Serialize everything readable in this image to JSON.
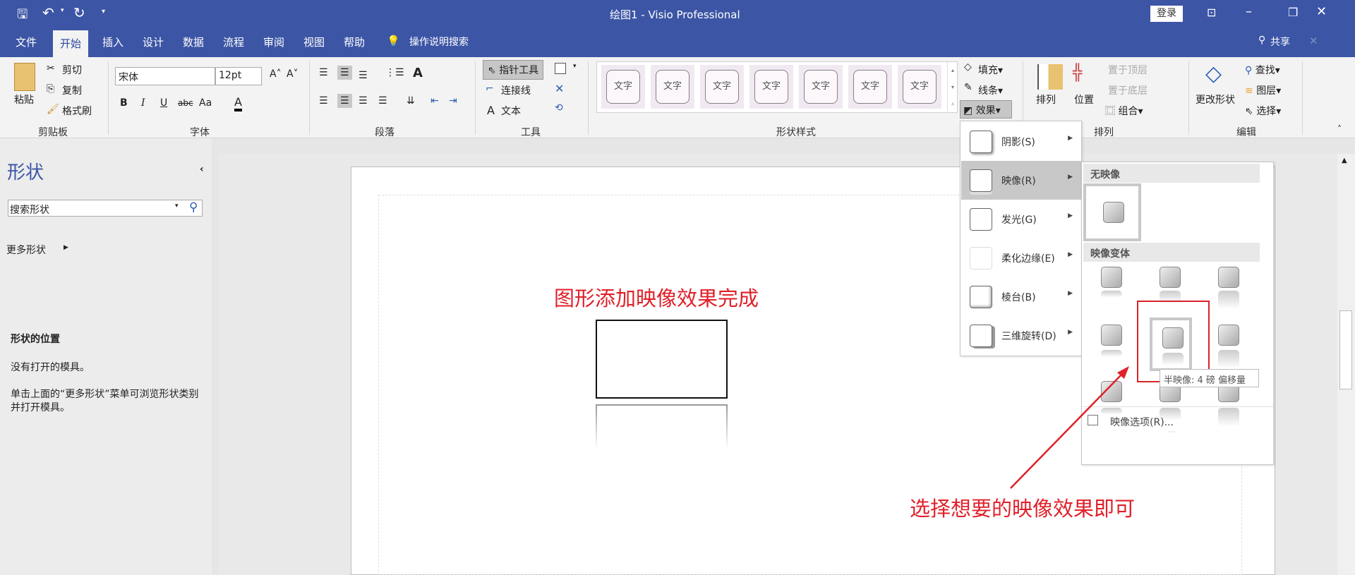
{
  "titlebar": {
    "title": "绘图1 - Visio Professional",
    "login": "登录",
    "quick_access": [
      "save-icon",
      "undo-icon",
      "redo-icon",
      "customize-icon"
    ]
  },
  "tabs": {
    "items": [
      "文件",
      "开始",
      "插入",
      "设计",
      "数据",
      "流程",
      "审阅",
      "视图",
      "帮助"
    ],
    "active": "开始",
    "tell_me": "操作说明搜索",
    "share": "共享"
  },
  "ribbon": {
    "clipboard": {
      "label": "剪贴板",
      "paste": "粘贴",
      "cut": "剪切",
      "copy": "复制",
      "format_painter": "格式刷"
    },
    "font": {
      "label": "字体",
      "font_name": "宋体",
      "font_size": "12pt",
      "bold": "B",
      "italic": "I",
      "underline": "U",
      "strike": "abc",
      "case": "Aa",
      "color": "A"
    },
    "paragraph": {
      "label": "段落"
    },
    "tools": {
      "label": "工具",
      "pointer": "指针工具",
      "connector": "连接线",
      "text": "文本"
    },
    "shape_styles": {
      "label": "形状样式",
      "items": [
        "文字",
        "文字",
        "文字",
        "文字",
        "文字",
        "文字",
        "文字"
      ],
      "fill": "填充",
      "line": "线条",
      "effects": "效果"
    },
    "arrange": {
      "label": "排列",
      "arrange": "排列",
      "position": "位置",
      "bring_front": "置于顶层",
      "send_back": "置于底层",
      "group": "组合"
    },
    "editing": {
      "label": "编辑",
      "change_shape": "更改形状",
      "find": "查找",
      "layers": "图层",
      "select": "选择"
    }
  },
  "shapes_panel": {
    "title": "形状",
    "search_placeholder": "搜索形状",
    "more_shapes": "更多形状",
    "location_heading": "形状的位置",
    "no_stencils": "没有打开的模具。",
    "hint": "单击上面的“更多形状”菜单可浏览形状类别并打开模具。"
  },
  "canvas": {
    "annotation_top": "图形添加映像效果完成",
    "annotation_bottom": "选择想要的映像效果即可",
    "annotation_color": "#e0202a"
  },
  "effects_menu": {
    "items": [
      {
        "label": "阴影(S)"
      },
      {
        "label": "映像(R)"
      },
      {
        "label": "发光(G)"
      },
      {
        "label": "柔化边缘(E)"
      },
      {
        "label": "棱台(B)"
      },
      {
        "label": "三维旋转(D)"
      }
    ],
    "highlighted": "映像(R)"
  },
  "reflection_menu": {
    "no_reflection": "无映像",
    "variations": "映像变体",
    "tooltip": "半映像: 4 磅 偏移量",
    "options": "映像选项(R)..."
  }
}
